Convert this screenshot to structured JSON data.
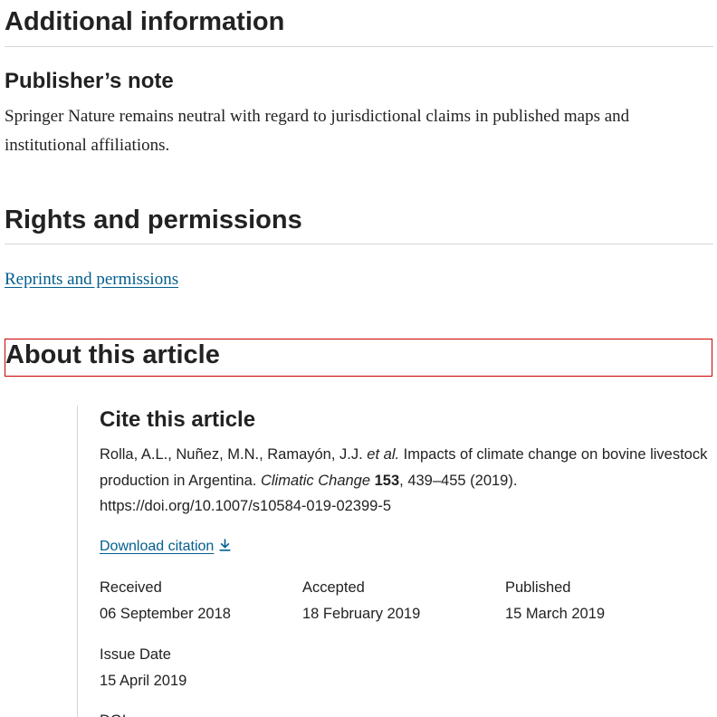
{
  "additional_info": {
    "heading": "Additional information",
    "publishers_note": {
      "heading": "Publisher’s note",
      "text": "Springer Nature remains neutral with regard to jurisdictional claims in published maps and institutional affiliations."
    }
  },
  "rights": {
    "heading": "Rights and permissions",
    "link_label": "Reprints and permissions"
  },
  "about": {
    "heading": "About this article"
  },
  "cite": {
    "heading": "Cite this article",
    "authors": "Rolla, A.L., Nuñez, M.N., Ramayón, J.J.",
    "et_al": "et al.",
    "title": "Impacts of climate change on bovine livestock production in Argentina.",
    "journal": "Climatic Change",
    "volume": "153",
    "pages_year": ", 439–455 (2019).",
    "doi_url": "https://doi.org/10.1007/s10584-019-02399-5",
    "download_label": "Download citation",
    "download_icon": "download-icon"
  },
  "history": {
    "received": {
      "label": "Received",
      "value": "06 September 2018"
    },
    "accepted": {
      "label": "Accepted",
      "value": "18 February 2019"
    },
    "published": {
      "label": "Published",
      "value": "15 March 2019"
    },
    "issue_date": {
      "label": "Issue Date",
      "value": "15 April 2019"
    },
    "doi_label": "DOI"
  },
  "colors": {
    "link": "#025e8d",
    "text": "#222222",
    "rule": "#d5d5d5",
    "highlight_box": "#cc0000"
  }
}
